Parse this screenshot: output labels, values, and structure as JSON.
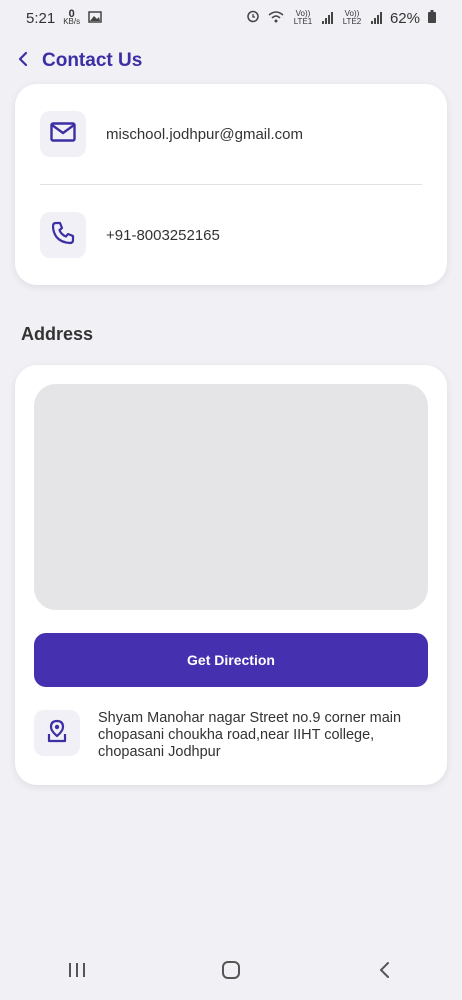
{
  "status_bar": {
    "time": "5:21",
    "speed_value": "0",
    "speed_unit": "KB/s",
    "lte1_label": "Vo)) LTE1",
    "lte2_label": "Vo)) LTE2",
    "battery": "62%"
  },
  "header": {
    "title": "Contact Us",
    "back_icon": "chevron-left-icon"
  },
  "contact": {
    "email": "mischool.jodhpur@gmail.com",
    "phone": "+91-8003252165",
    "email_icon": "mail-icon",
    "phone_icon": "phone-icon"
  },
  "address": {
    "section_title": "Address",
    "button_label": "Get Direction",
    "text": "Shyam Manohar nagar Street no.9 corner main chopasani choukha road,near IIHT college, chopasani Jodhpur",
    "location_icon": "location-pin-icon"
  },
  "nav": {
    "recent_icon": "recent-apps-icon",
    "home_icon": "home-icon",
    "back_icon": "back-icon"
  },
  "colors": {
    "accent": "#4531b0",
    "title": "#3b2fa3",
    "background": "#f1f0f5"
  }
}
